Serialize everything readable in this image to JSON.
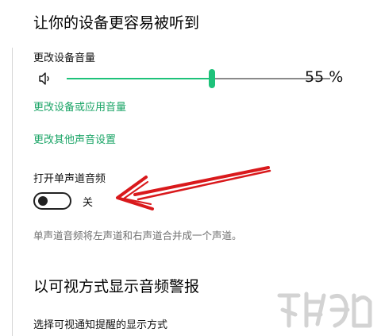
{
  "section1": {
    "title": "让你的设备更容易被听到",
    "volume_label": "更改设备音量",
    "volume_value": "55 %",
    "volume_level": 0.55,
    "link_app_volume": "更改设备或应用音量",
    "link_other_sound": "更改其他声音设置",
    "mono_label": "打开单声道音频",
    "mono_state": "关",
    "mono_description": "单声道音频将左声道和右声道合并成一个声道。"
  },
  "section2": {
    "title": "以可视方式显示音频警报",
    "notify_label": "选择可视通知提醒的显示方式"
  },
  "icons": {
    "speaker": "speaker-icon"
  },
  "colors": {
    "accent": "#1ec27a",
    "link": "#1aa466",
    "arrow": "#d9191c"
  }
}
